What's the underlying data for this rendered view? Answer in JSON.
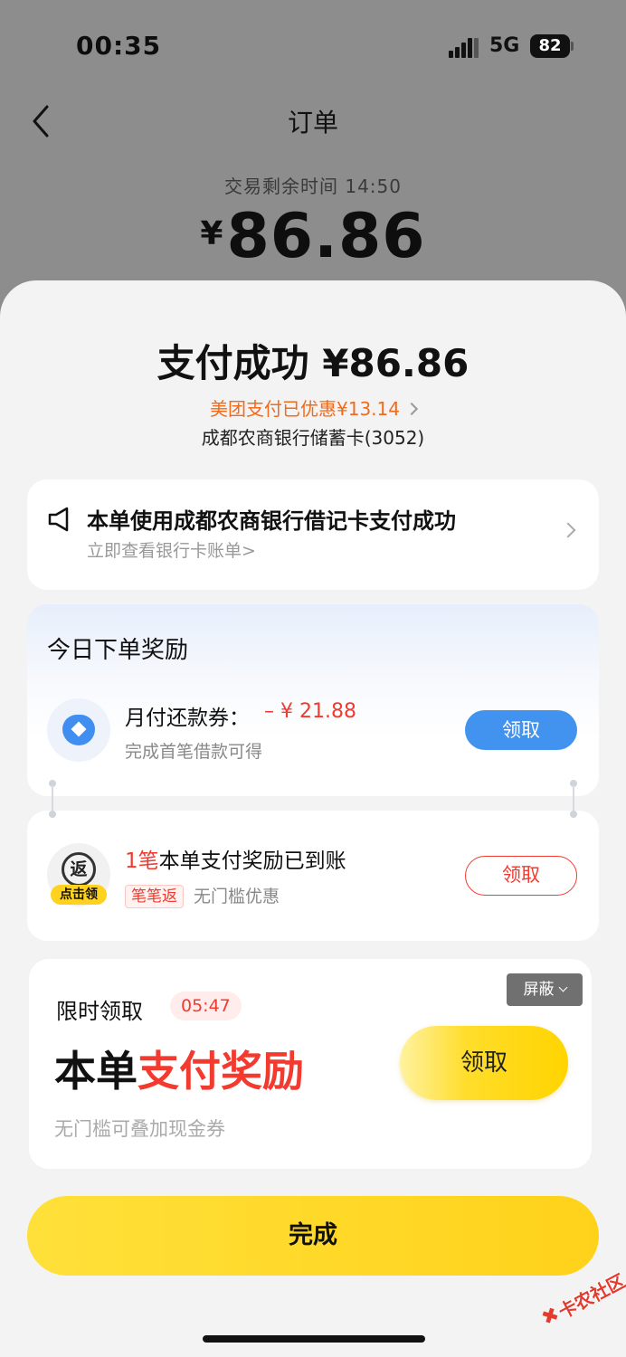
{
  "status_bar": {
    "time": "00:35",
    "network": "5G",
    "battery": "82"
  },
  "nav": {
    "title": "订单"
  },
  "header": {
    "remaining_time": "交易剩余时间 14:50",
    "currency": "¥",
    "amount": "86.86"
  },
  "result": {
    "title": "支付成功 ¥86.86",
    "discount": "美团支付已优惠¥13.14",
    "card": "成都农商银行储蓄卡(3052)"
  },
  "notice": {
    "title": "本单使用成都农商银行借记卡支付成功",
    "link": "立即查看银行卡账单>"
  },
  "reward": {
    "heading": "今日下单奖励",
    "item_name": "月付还款券：",
    "item_value": "– ¥ 21.88",
    "item_sub": "完成首笔借款可得",
    "button": "领取"
  },
  "cashback": {
    "icon_char": "返",
    "icon_tag": "点击领",
    "count": "1笔",
    "title_rest": "本单支付奖励已到账",
    "badge": "笔笔返",
    "sub": "无门槛优惠",
    "button": "领取"
  },
  "limited": {
    "heading": "限时领取",
    "timer": "05:47",
    "block_button": "屏蔽",
    "big_black": "本单",
    "big_red": "支付奖励",
    "sub": "无门槛可叠加现金券",
    "button": "领取"
  },
  "done_button": "完成",
  "watermark": "卡农社区",
  "colors": {
    "accent_red": "#f23a2f",
    "brand_yellow": "#ffd21a",
    "blue": "#4292f0",
    "orange": "#f26a1b"
  }
}
